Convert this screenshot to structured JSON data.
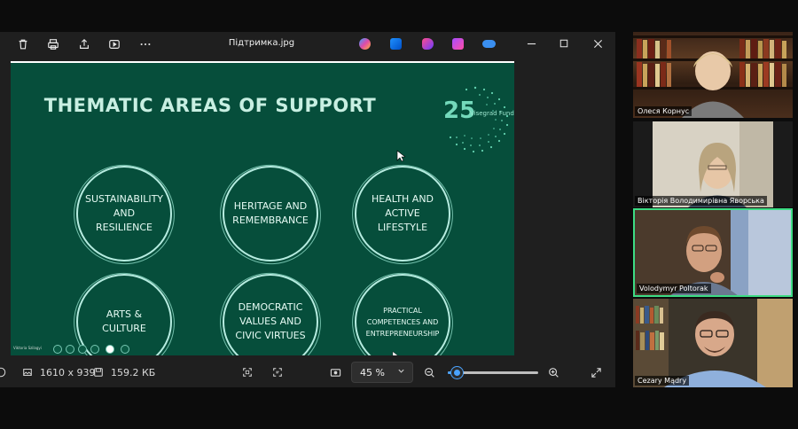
{
  "viewer": {
    "file_name": "Підтримка.jpg",
    "toolbar_icons": [
      "delete-icon",
      "print-icon",
      "share-icon",
      "slideshow-icon",
      "more-icon"
    ],
    "app_icons": [
      "copilot-icon",
      "editor-icon",
      "clipchamp-icon",
      "designer-icon",
      "onedrive-icon"
    ]
  },
  "slide": {
    "title": "THEMATIC AREAS OF SUPPORT",
    "fund_number": "25",
    "fund_name": "Visegrad Fund",
    "areas": [
      {
        "lines": [
          "SUSTAINABILITY",
          "AND",
          "RESILIENCE"
        ]
      },
      {
        "lines": [
          "HERITAGE AND",
          "REMEMBRANCE"
        ]
      },
      {
        "lines": [
          "HEALTH AND",
          "ACTIVE",
          "LIFESTYLE"
        ]
      },
      {
        "lines": [
          "ARTS &",
          "CULTURE"
        ]
      },
      {
        "lines": [
          "DEMOCRATIC",
          "VALUES AND",
          "CIVIC VIRTUES"
        ]
      },
      {
        "lines": [
          "PRACTICAL",
          "COMPETENCES AND",
          "ENTREPRENEURSHIP"
        ]
      }
    ],
    "presenter_strip": "Viktoria Szilagyi"
  },
  "status": {
    "dimensions": "1610 x 939",
    "file_size": "159.2 КБ",
    "zoom": "45 %",
    "zoom_fraction": 0.1
  },
  "participants": [
    {
      "name": "Олеся Корнус"
    },
    {
      "name": "Вікторія Володимирівна Яворська"
    },
    {
      "name": "Volodymyr Poltorak"
    },
    {
      "name": "Cezary Mądry"
    }
  ],
  "colors": {
    "slide_bg": "#064e3b",
    "accent": "#4aa3ff",
    "active_speaker": "#3ddc84"
  }
}
